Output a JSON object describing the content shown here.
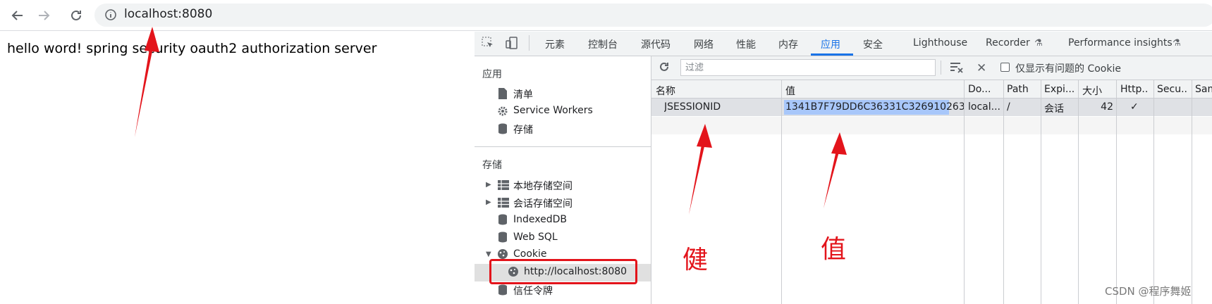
{
  "browser": {
    "url": "localhost:8080"
  },
  "page": {
    "text": "hello word! spring security oauth2 authorization server"
  },
  "devtools": {
    "tabs": [
      "元素",
      "控制台",
      "源代码",
      "网络",
      "性能",
      "内存",
      "应用",
      "安全",
      "Lighthouse",
      "Recorder",
      "Performance insights"
    ],
    "active_tab": "应用",
    "sidebar": {
      "app_heading": "应用",
      "app_items": [
        "清单",
        "Service Workers",
        "存储"
      ],
      "storage_heading": "存储",
      "storage_items": [
        "本地存储空间",
        "会话存储空间",
        "IndexedDB",
        "Web SQL",
        "Cookie"
      ],
      "cookie_child": "http://localhost:8080",
      "more_items": [
        "信任令牌"
      ]
    },
    "cookies": {
      "filter_placeholder": "过滤",
      "only_issues_label": "仅显示有问题的 Cookie",
      "columns": [
        "名称",
        "值",
        "Do...",
        "Path",
        "Expi...",
        "大小",
        "Http..",
        "Secu..",
        "Sam"
      ],
      "rows": [
        {
          "name": "JSESSIONID",
          "value": "1341B7F79DD6C36331C326910263...",
          "domain": "local...",
          "path": "/",
          "expires": "会话",
          "size": "42",
          "httponly": "✓",
          "secure": "",
          "samesite": ""
        }
      ]
    }
  },
  "annotations": {
    "key_label": "健",
    "value_label": "值",
    "color": "#e3141b"
  },
  "watermark": "CSDN @程序舞姬",
  "colors": {
    "accent": "#1a73e8",
    "selection": "#a8c7fa"
  }
}
